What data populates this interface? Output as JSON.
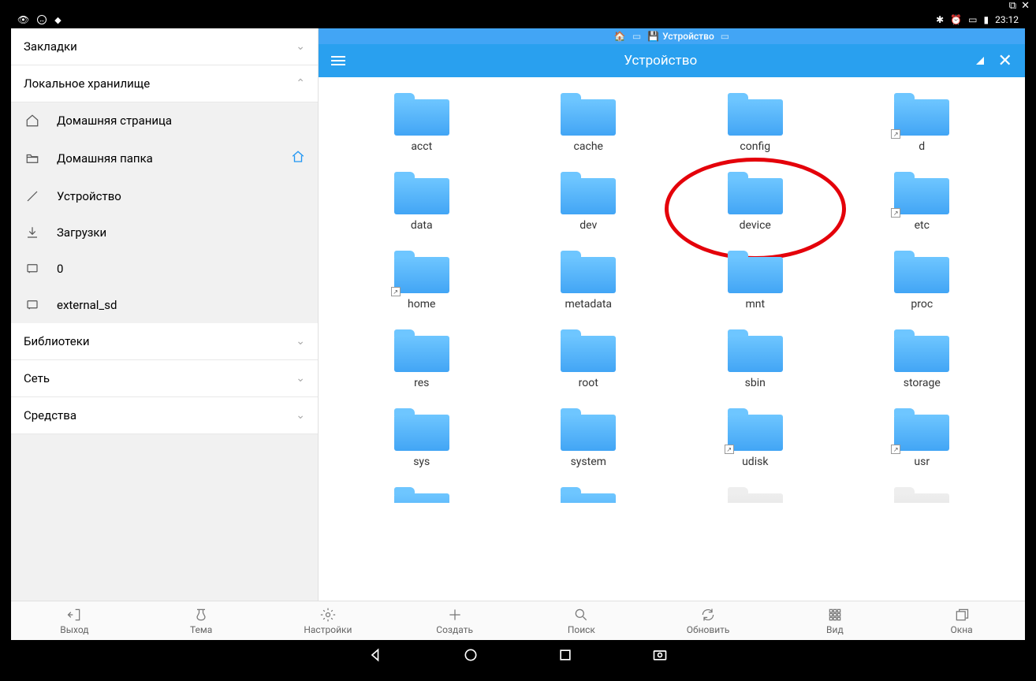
{
  "frame": {
    "popout": "↗",
    "close": "✕"
  },
  "status": {
    "time": "23:12"
  },
  "sidebar": {
    "sections": {
      "bookmarks": "Закладки",
      "local": "Локальное хранилище",
      "libraries": "Библиотеки",
      "network": "Сеть",
      "tools": "Средства"
    },
    "items": [
      {
        "label": "Домашняя страница"
      },
      {
        "label": "Домашняя папка"
      },
      {
        "label": "Устройство"
      },
      {
        "label": "Загрузки"
      },
      {
        "label": "0"
      },
      {
        "label": "external_sd"
      }
    ]
  },
  "breadcrumb": {
    "current": "Устройство"
  },
  "appbar": {
    "title": "Устройство"
  },
  "folders": [
    {
      "label": "acct"
    },
    {
      "label": "cache"
    },
    {
      "label": "config"
    },
    {
      "label": "d",
      "link": true
    },
    {
      "label": "data"
    },
    {
      "label": "dev"
    },
    {
      "label": "device",
      "highlight": true
    },
    {
      "label": "etc",
      "link": true
    },
    {
      "label": "home",
      "link": true
    },
    {
      "label": "metadata"
    },
    {
      "label": "mnt"
    },
    {
      "label": "proc"
    },
    {
      "label": "res"
    },
    {
      "label": "root"
    },
    {
      "label": "sbin"
    },
    {
      "label": "storage"
    },
    {
      "label": "sys"
    },
    {
      "label": "system"
    },
    {
      "label": "udisk",
      "link": true
    },
    {
      "label": "usr",
      "link": true
    }
  ],
  "toolbar": [
    {
      "label": "Выход"
    },
    {
      "label": "Тема"
    },
    {
      "label": "Настройки"
    },
    {
      "label": "Создать"
    },
    {
      "label": "Поиск"
    },
    {
      "label": "Обновить"
    },
    {
      "label": "Вид"
    },
    {
      "label": "Окна"
    }
  ]
}
